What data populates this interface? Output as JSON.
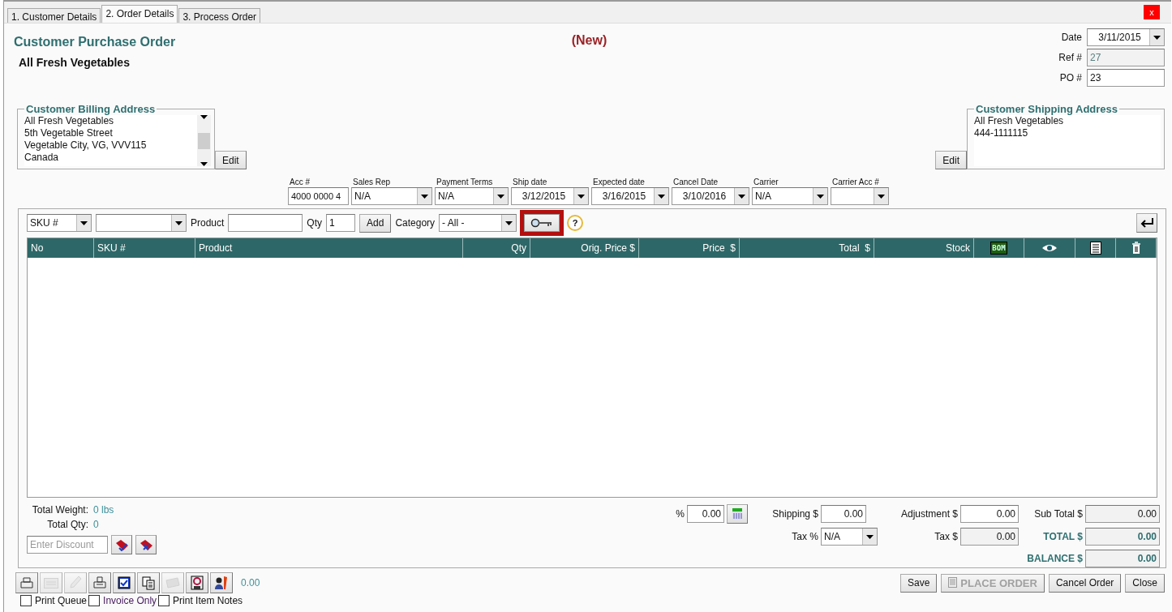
{
  "tabs": [
    {
      "label": "1. Customer Details",
      "selected": false
    },
    {
      "label": "2. Order Details",
      "selected": true
    },
    {
      "label": "3. Process Order",
      "selected": false
    }
  ],
  "close_button": "x",
  "title": "Customer Purchase Order",
  "customer": "All Fresh Vegetables",
  "status": "(New)",
  "header_fields": [
    {
      "label": "Date",
      "value": "3/11/2015",
      "kind": "dropdown"
    },
    {
      "label": "Ref #",
      "value": "27",
      "kind": "readonly"
    },
    {
      "label": "PO #",
      "value": "23",
      "kind": "text"
    }
  ],
  "billing_address": {
    "title": "Customer Billing Address",
    "lines": [
      "All Fresh Vegetables",
      "5th Vegetable Street",
      "Vegetable City, VG, VVV115",
      "Canada"
    ],
    "edit": "Edit"
  },
  "shipping_address": {
    "title": "Customer Shipping Address",
    "lines": [
      "All Fresh Vegetables",
      "444-1111115"
    ],
    "edit": "Edit"
  },
  "order_fields": [
    {
      "label": "Acc #",
      "value": "4000 0000 4",
      "kind": "text"
    },
    {
      "label": "Sales Rep",
      "value": "N/A",
      "kind": "dropdown"
    },
    {
      "label": "Payment Terms",
      "value": "N/A",
      "kind": "dropdown"
    },
    {
      "label": "Ship date",
      "value": "3/12/2015",
      "kind": "date"
    },
    {
      "label": "Expected date",
      "value": "3/16/2015",
      "kind": "date"
    },
    {
      "label": "Cancel Date",
      "value": "3/10/2016",
      "kind": "date"
    },
    {
      "label": "Carrier",
      "value": "N/A",
      "kind": "dropdown"
    },
    {
      "label": "Carrier Acc #",
      "kind": "dropdown"
    }
  ],
  "item_entry": {
    "lookup": "SKU #",
    "product_label": "Product",
    "qty_label": "Qty",
    "qty": "1",
    "add": "Add",
    "category_label": "Category",
    "category": "- All -",
    "search_highlighted": true,
    "help": "?"
  },
  "table": {
    "columns": [
      {
        "label": "No",
        "kind": "text"
      },
      {
        "label": "SKU #",
        "kind": "text"
      },
      {
        "label": "Product",
        "kind": "text"
      },
      {
        "label": "Qty",
        "kind": "text"
      },
      {
        "label": "Orig. Price $",
        "kind": "text"
      },
      {
        "label": "Price  $",
        "kind": "text"
      },
      {
        "label": "Total  $",
        "kind": "text"
      },
      {
        "label": "Stock",
        "kind": "text"
      },
      {
        "label": "BOM",
        "kind": "badge"
      },
      {
        "kind": "eye"
      },
      {
        "kind": "list"
      },
      {
        "kind": "trash"
      }
    ]
  },
  "summary": {
    "weight_label": "Total Weight:",
    "weight": "0 lbs",
    "qty_label": "Total Qty:",
    "qty": "0",
    "discount_placeholder": "Enter Discount"
  },
  "totals": {
    "percent_label": "%",
    "percent": "0.00",
    "shipping_label": "Shipping $",
    "shipping": "0.00",
    "adjustment_label": "Adjustment $",
    "adjustment": "0.00",
    "subtotal_label": "Sub Total $",
    "subtotal": "0.00",
    "tax_pct_label": "Tax %",
    "tax_pct": "N/A",
    "tax_label": "Tax $",
    "tax": "0.00",
    "total_label": "TOTAL $",
    "total": "0.00",
    "balance_label": "BALANCE $",
    "balance": "0.00"
  },
  "toolbar": [
    {
      "kind": "printer",
      "disabled": false
    },
    {
      "kind": "envelope",
      "disabled": true
    },
    {
      "kind": "pen",
      "disabled": true
    },
    {
      "kind": "fax",
      "disabled": false
    },
    {
      "kind": "check",
      "disabled": false
    },
    {
      "kind": "copy",
      "disabled": false
    },
    {
      "kind": "ticket",
      "disabled": true
    },
    {
      "kind": "disk",
      "disabled": false
    },
    {
      "kind": "person",
      "disabled": false
    }
  ],
  "toolbar_amount": "0.00",
  "actions": [
    {
      "label": "Save",
      "disabled": false
    },
    {
      "label": "PLACE ORDER",
      "disabled": true
    },
    {
      "label": "Cancel Order",
      "disabled": false
    },
    {
      "label": "Close",
      "disabled": false
    }
  ],
  "options": [
    {
      "label": "Print Queue",
      "checked": false
    },
    {
      "label": "Invoice Only",
      "checked": false
    },
    {
      "label": "Print Item Notes",
      "checked": false
    }
  ]
}
